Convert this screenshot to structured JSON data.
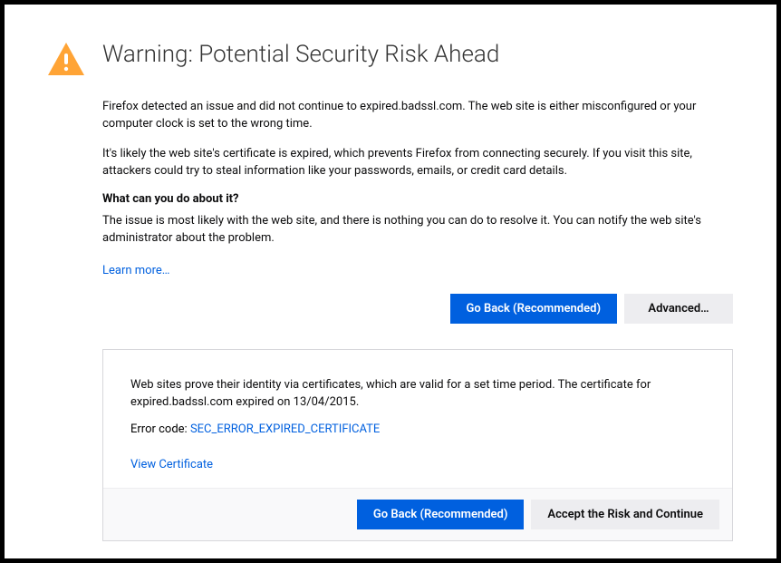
{
  "title": "Warning: Potential Security Risk Ahead",
  "para1": "Firefox detected an issue and did not continue to expired.badssl.com. The web site is either misconfigured or your computer clock is set to the wrong time.",
  "para2": "It's likely the web site's certificate is expired, which prevents Firefox from connecting securely. If you visit this site, attackers could try to steal information like your passwords, emails, or credit card details.",
  "subhead": "What can you do about it?",
  "para3": "The issue is most likely with the web site, and there is nothing you can do to resolve it. You can notify the web site's administrator about the problem.",
  "learn_more": "Learn more…",
  "buttons": {
    "go_back": "Go Back (Recommended)",
    "advanced": "Advanced…",
    "accept_risk": "Accept the Risk and Continue"
  },
  "advanced": {
    "explain": "Web sites prove their identity via certificates, which are valid for a set time period. The certificate for expired.badssl.com expired on 13/04/2015.",
    "error_label": "Error code: ",
    "error_code": "SEC_ERROR_EXPIRED_CERTIFICATE",
    "view_cert": "View Certificate"
  }
}
